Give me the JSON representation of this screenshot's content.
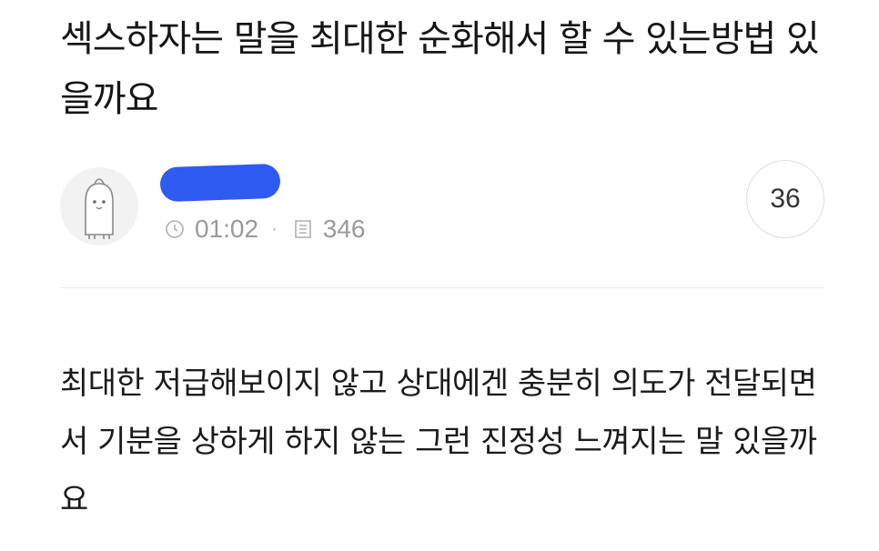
{
  "post": {
    "title": "섹스하자는 말을 최대한 순화해서 할 수 있는방법 있을까요",
    "body": "최대한 저급해보이지 않고 상대에겐 충분히 의도가 전달되면서 기분을 상하게 하지 않는 그런 진정성 느껴지는 말 있을까요"
  },
  "author": {
    "avatar_icon": "ghost-character-avatar-icon",
    "name_redacted_color": "#2f5bf0"
  },
  "meta": {
    "time_icon": "clock-icon",
    "time": "01:02",
    "separator": "·",
    "views_icon": "document-icon",
    "views": "346"
  },
  "comments": {
    "count": "36"
  }
}
